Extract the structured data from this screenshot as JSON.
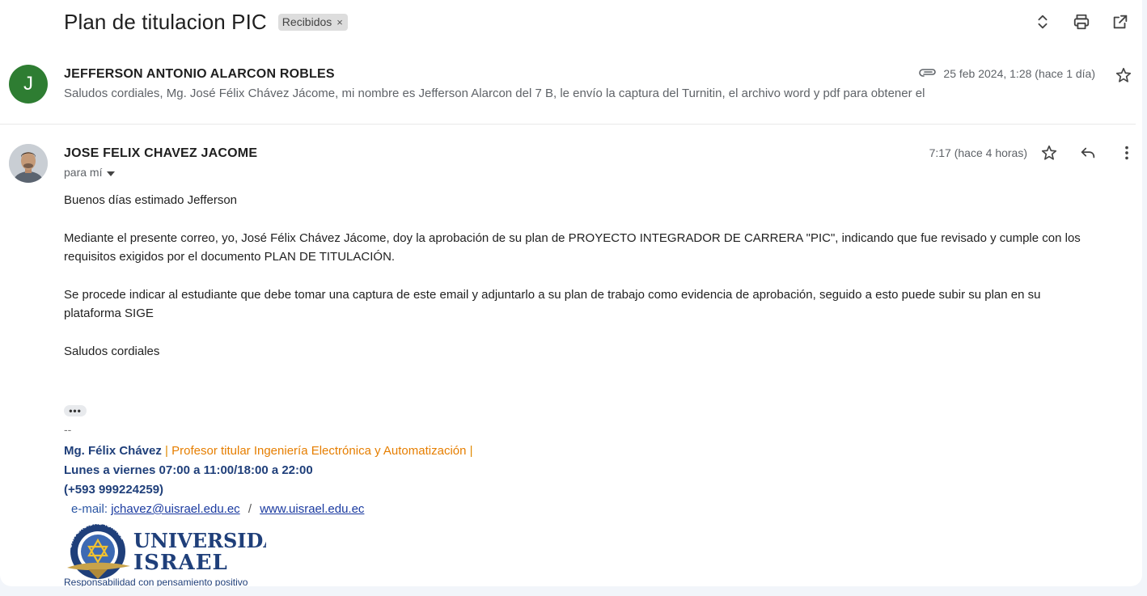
{
  "thread": {
    "subject": "Plan de titulacion PIC",
    "label": "Recibidos",
    "label_remove": "×"
  },
  "toolbar": {
    "icons": [
      "expand-collapse-icon",
      "print-icon",
      "open-new-window-icon"
    ]
  },
  "message1": {
    "avatar_initial": "J",
    "avatar_color": "#2e7d32",
    "sender": "JEFFERSON ANTONIO ALARCON ROBLES",
    "snippet": "Saludos cordiales, Mg. José Félix Chávez Jácome, mi nombre es Jefferson Alarcon del 7 B, le envío la captura del Turnitin, el archivo word y pdf para obtener el",
    "date": "25 feb 2024, 1:28 (hace 1 día)",
    "has_attachment": true
  },
  "message2": {
    "sender": "JOSE FELIX CHAVEZ JACOME",
    "to": "para mí",
    "date": "7:17 (hace 4 horas)",
    "body": {
      "greeting": "Buenos días estimado Jefferson",
      "para1_line1": "Mediante el presente correo, yo, José Félix Chávez Jácome, doy la aprobación de su plan de PROYECTO INTEGRADOR DE CARRERA \"PIC\", indicando que fue revisado y cumple con los",
      "para1_line2": "requisitos exigidos por el documento PLAN DE TITULACIÓN.",
      "para2_line1": "Se procede indicar al estudiante que debe tomar una captura de este email y adjuntarlo a su plan de trabajo como evidencia de aprobación, seguido a esto puede subir su plan en su",
      "para2_line2": "plataforma SIGE",
      "closing": "Saludos cordiales"
    },
    "signature": {
      "dash": "--",
      "name": "Mg. Félix Chávez",
      "sep": "|",
      "role": "Profesor titular Ingeniería Electrónica y Automatización",
      "sep2": "|",
      "hours": "Lunes a viernes 07:00 a 11:00/18:00 a 22:00",
      "phone": "(+593 999224259)",
      "email_label": "e-mail:",
      "email": "jchavez@uisrael.edu.ec",
      "slash": "/",
      "website": "www.uisrael.edu.ec",
      "logo_line1": "UNIVERSIDAD",
      "logo_line2": "ISRAEL",
      "logo_ring": "UNIVERSIDAD ISRAEL",
      "tagline": "Responsabilidad con pensamiento positivo"
    }
  },
  "colors": {
    "signature_blue": "#1f3f7a",
    "signature_orange": "#e67e00",
    "link_blue": "#1a3aa0"
  }
}
